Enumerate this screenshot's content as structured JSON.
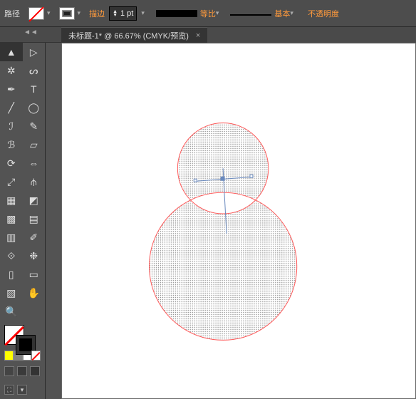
{
  "top": {
    "mode_label": "路径",
    "stroke_label": "描边",
    "stroke_value": "1 pt",
    "profile1": "等比",
    "profile2": "基本",
    "opacity_label": "不透明度"
  },
  "tab": {
    "title": "未标题-1* @ 66.67% (CMYK/预览)"
  },
  "sidepanel": {
    "collapse": "◄◄"
  },
  "tools": [
    {
      "n": "selection-tool",
      "g": "▲"
    },
    {
      "n": "direct-selection-tool",
      "g": "▷"
    },
    {
      "n": "magic-wand-tool",
      "g": "✲"
    },
    {
      "n": "lasso-tool",
      "g": "ᔕ"
    },
    {
      "n": "pen-tool",
      "g": "✒"
    },
    {
      "n": "type-tool",
      "g": "T"
    },
    {
      "n": "line-tool",
      "g": "╱"
    },
    {
      "n": "ellipse-tool",
      "g": "◯"
    },
    {
      "n": "paintbrush-tool",
      "g": "ℐ"
    },
    {
      "n": "pencil-tool",
      "g": "✎"
    },
    {
      "n": "blob-brush-tool",
      "g": "ℬ"
    },
    {
      "n": "eraser-tool",
      "g": "▱"
    },
    {
      "n": "rotate-tool",
      "g": "⟳"
    },
    {
      "n": "reflect-tool",
      "g": "⇔"
    },
    {
      "n": "scale-tool",
      "g": "⤢"
    },
    {
      "n": "width-tool",
      "g": "⫛"
    },
    {
      "n": "free-transform-tool",
      "g": "▦"
    },
    {
      "n": "shape-builder-tool",
      "g": "◩"
    },
    {
      "n": "perspective-grid-tool",
      "g": "▩"
    },
    {
      "n": "mesh-tool",
      "g": "▤"
    },
    {
      "n": "gradient-tool",
      "g": "▥"
    },
    {
      "n": "eyedropper-tool",
      "g": "✐"
    },
    {
      "n": "blend-tool",
      "g": "⟐"
    },
    {
      "n": "symbol-sprayer-tool",
      "g": "❉"
    },
    {
      "n": "column-graph-tool",
      "g": "▯"
    },
    {
      "n": "artboard-tool",
      "g": "▭"
    },
    {
      "n": "slice-tool",
      "g": "▨"
    },
    {
      "n": "hand-tool",
      "g": "✋"
    },
    {
      "n": "zoom-tool",
      "g": "🔍"
    },
    {
      "n": "spacer",
      "g": ""
    }
  ],
  "swatches": {
    "row1": [
      "#ffff00",
      "#808080",
      "#ffffff"
    ],
    "row2": [
      "#444",
      "#3a3a3a",
      "#333"
    ]
  },
  "canvas": {
    "stroke": "#ff5a5a",
    "fill_pattern": "gray-dots",
    "anchor_color": "#6a8abf"
  },
  "chart_data": {
    "type": "table",
    "note": "Vector shape on canvas — compound path of two overlapping circles (snowman outline) with dotted fill and red stroke; anchor/handle visible at circle intersection."
  }
}
